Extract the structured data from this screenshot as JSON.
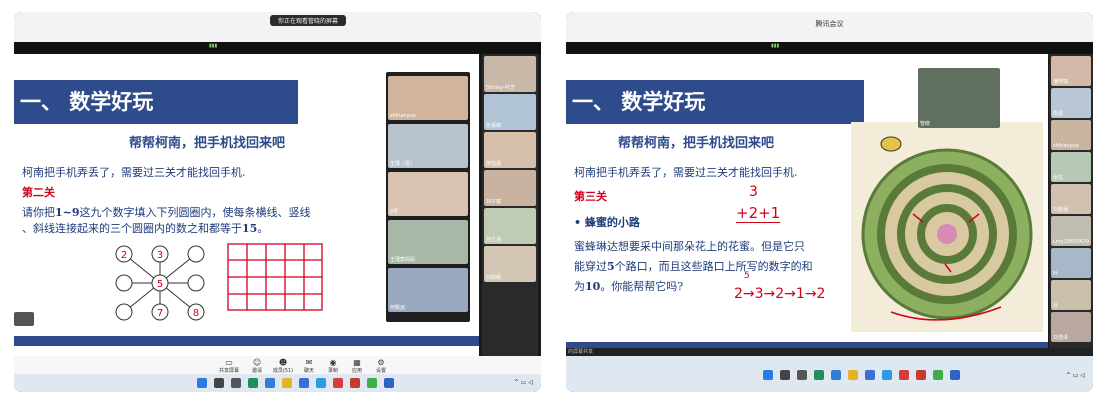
{
  "left_window": {
    "share_notice": "你正在观看管晓的屏幕",
    "slide": {
      "banner": "一、 数学好玩",
      "subtitle": "帮帮柯南，把手机找回来吧",
      "line1": "柯南把手机弄丢了，需要过三关才能找回手机.",
      "level": "第二关",
      "instr_pre": "请你把",
      "instr_bold": "1~9",
      "instr_post": "这九个数字填入下列圆圈内，使每条横线、竖线",
      "instr2": "、斜线连接起来的三个圆圈内的数之和都等于",
      "instr2_bold": "15",
      "instr2_end": "。",
      "circle_digits": [
        "2",
        "3",
        "5",
        "7",
        "8"
      ]
    },
    "gallery": [
      "shihaoyue",
      "王瑾（喜）",
      "9号",
      "王瑾宸妈妈",
      "何致远"
    ],
    "sidebar": [
      "Shirley-叶芝",
      "张语菲",
      "张钰涵",
      "刘子瑜",
      "孙立涵",
      "刘祥辉"
    ],
    "toolbar": [
      "共享屏幕",
      "邀请",
      "成员(51)",
      "聊天",
      "录制",
      "应用",
      "设置"
    ]
  },
  "right_window": {
    "title": "腾讯会议",
    "slide": {
      "banner": "一、 数学好玩",
      "subtitle": "帮帮柯南，把手机找回来吧",
      "line1": "柯南把手机弄丢了，需要过三关才能找回手机.",
      "level": "第三关",
      "bullet": "• 蜂蜜的小路",
      "para1": "蜜蜂琳达想要采中间那朵花上的花蜜。但是它只",
      "para2_a": "能穿过",
      "para2_bold": "5",
      "para2_b": "个路口，而且这些路口上所写的数字的和",
      "para3_a": "为",
      "para3_bold": "10",
      "para3_b": "。你能帮帮它吗?",
      "handwriting_top": "3",
      "handwriting_eq": "+2+1",
      "handwriting_path": "2→3→2→1→2",
      "handwriting_five": "5"
    },
    "teacher": "管晓",
    "sidebar": [
      "潘梓琪",
      "陈嘉",
      "shihaoyue",
      "张钰",
      "刘紫涵",
      "Lmy19850429",
      "叶",
      "孙",
      "刘浩泽"
    ],
    "status": "的屏幕共享"
  },
  "colors": {
    "banner": "#2e4b8c",
    "red_text": "#d0021b",
    "body_text": "#1e3c7a",
    "handwriting": "#d0021b"
  }
}
